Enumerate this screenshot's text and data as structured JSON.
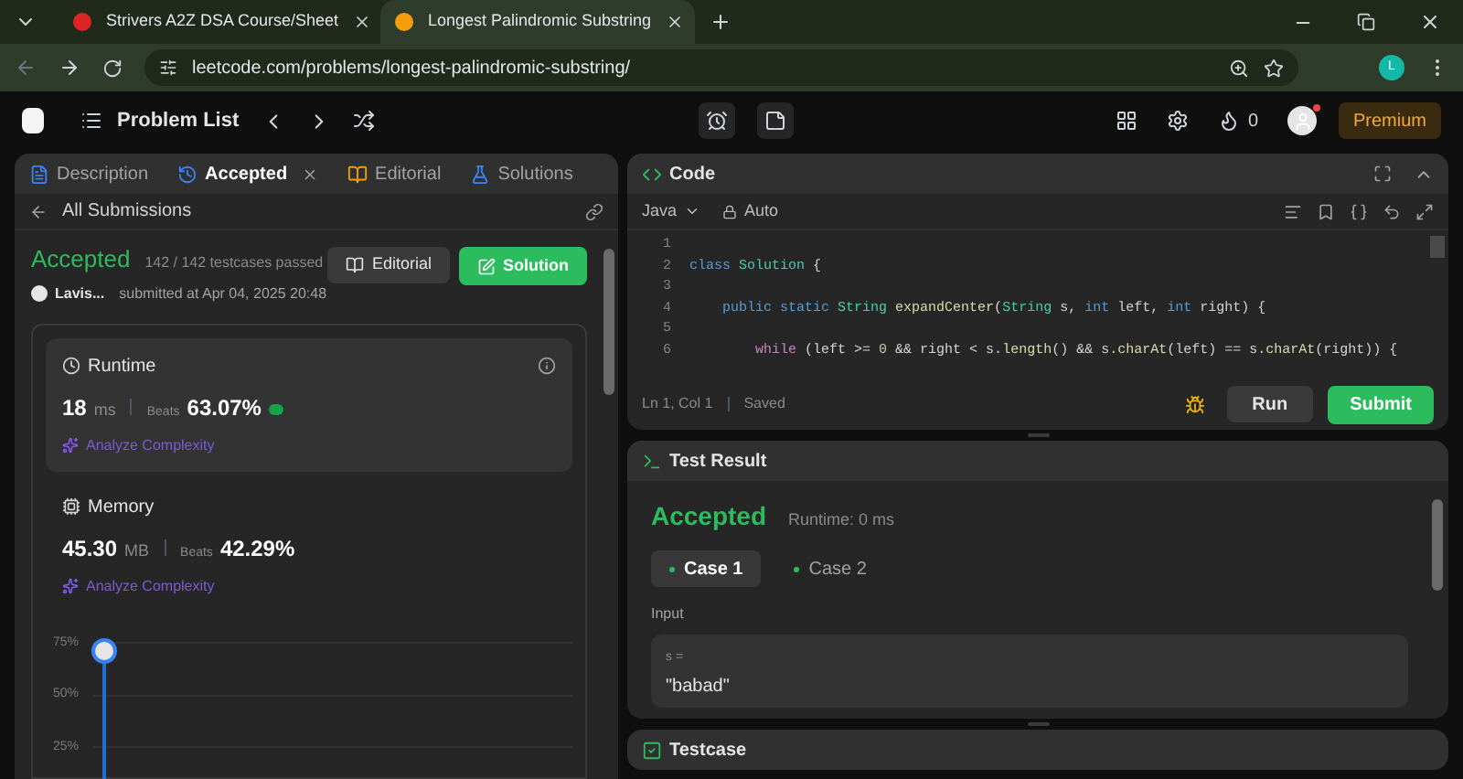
{
  "browser": {
    "tabs": [
      {
        "title": "Strivers A2Z DSA Course/Sheet",
        "selected": false,
        "kind": "tuf"
      },
      {
        "title": "Longest Palindromic Substring",
        "selected": true,
        "kind": "leetcode"
      }
    ],
    "url": "leetcode.com/problems/longest-palindromic-substring/",
    "profile_initial": "L"
  },
  "nav": {
    "title": "Problem List",
    "streak": "0",
    "premium": "Premium"
  },
  "left_panel": {
    "tabs": [
      {
        "label": "Description",
        "selected": false,
        "kind": "description"
      },
      {
        "label": "Accepted",
        "selected": true,
        "kind": "submission"
      },
      {
        "label": "Editorial",
        "selected": false,
        "kind": "editorial"
      },
      {
        "label": "Solutions",
        "selected": false,
        "kind": "solutions"
      }
    ],
    "back_link": "All Submissions",
    "submission": {
      "status": "Accepted",
      "testcases": "142 / 142 testcases passed",
      "user": "Lavis...",
      "submitted": "submitted at Apr 04, 2025 20:48"
    },
    "editorial_button": "Editorial",
    "solution_button": "Solution",
    "stats": [
      {
        "kind": "runtime",
        "title": "Runtime",
        "value": "18",
        "unit": "ms",
        "beats_label": "Beats",
        "beats": "63.07%",
        "analyze": "Analyze Complexity",
        "selected": true
      },
      {
        "kind": "memory",
        "title": "Memory",
        "value": "45.30",
        "unit": "MB",
        "beats_label": "Beats",
        "beats": "42.29%",
        "analyze": "Analyze Complexity",
        "selected": false
      }
    ],
    "chart_ticks": [
      "75%",
      "50%",
      "25%"
    ]
  },
  "code_panel": {
    "title": "Code",
    "language": "Java",
    "mode": "Auto",
    "lines": [
      {
        "number": "1"
      },
      {
        "number": "2",
        "tokens": [
          {
            "text": "class ",
            "kind": "keyword"
          },
          {
            "text": "Solution",
            "kind": "type"
          },
          {
            "text": " {",
            "kind": "plain"
          }
        ]
      },
      {
        "number": "3"
      },
      {
        "number": "4",
        "tokens": [
          {
            "text": "    public static ",
            "kind": "keyword"
          },
          {
            "text": "String ",
            "kind": "type"
          },
          {
            "text": "expandCenter",
            "kind": "function"
          },
          {
            "text": "(",
            "kind": "plain"
          },
          {
            "text": "String",
            "kind": "type"
          },
          {
            "text": " s, ",
            "kind": "plain"
          },
          {
            "text": "int",
            "kind": "keyword"
          },
          {
            "text": " left, ",
            "kind": "plain"
          },
          {
            "text": "int",
            "kind": "keyword"
          },
          {
            "text": " right) {",
            "kind": "plain"
          }
        ]
      },
      {
        "number": "5"
      },
      {
        "number": "6",
        "tokens": [
          {
            "text": "        while",
            "kind": "control"
          },
          {
            "text": " (left >= ",
            "kind": "plain"
          },
          {
            "text": "0",
            "kind": "number"
          },
          {
            "text": " && right < s.",
            "kind": "plain"
          },
          {
            "text": "length",
            "kind": "function"
          },
          {
            "text": "() && s.",
            "kind": "plain"
          },
          {
            "text": "charAt",
            "kind": "function"
          },
          {
            "text": "(left) == s.",
            "kind": "plain"
          },
          {
            "text": "charAt",
            "kind": "function"
          },
          {
            "text": "(right)) {",
            "kind": "plain"
          }
        ]
      }
    ],
    "cursor": "Ln 1, Col 1",
    "saved": "Saved",
    "run_button": "Run",
    "submit_button": "Submit"
  },
  "test_result": {
    "title": "Test Result",
    "verdict": "Accepted",
    "runtime": "Runtime: 0 ms",
    "cases": [
      {
        "label": "Case 1",
        "selected": true
      },
      {
        "label": "Case 2",
        "selected": false
      }
    ],
    "input_label": "Input",
    "variable": "s =",
    "value": "\"babad\""
  },
  "testcase": {
    "title": "Testcase"
  }
}
